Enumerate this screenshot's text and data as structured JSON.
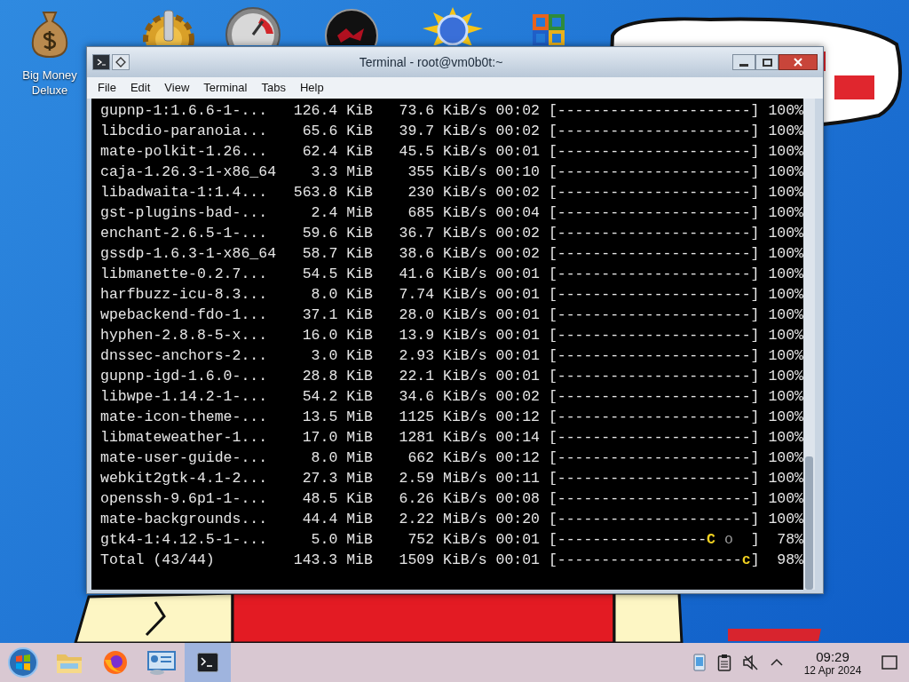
{
  "desktop": {
    "icons": [
      {
        "kind": "money-bag",
        "label": "Big Money Deluxe"
      },
      {
        "kind": "gear"
      },
      {
        "kind": "gauge"
      },
      {
        "kind": "disc"
      },
      {
        "kind": "sun-globe"
      },
      {
        "kind": "office"
      }
    ]
  },
  "window": {
    "title": "Terminal - root@vm0b0t:~",
    "menu": [
      "File",
      "Edit",
      "View",
      "Terminal",
      "Tabs",
      "Help"
    ],
    "rows": [
      {
        "name": "gupnp-1:1.6.6-1-...",
        "size": "126.4 KiB",
        "rate": "73.6 KiB/s",
        "time": "00:02",
        "bar": [
          {
            "kind": "trail",
            "text": "[----------------------]"
          }
        ],
        "percent": "100%"
      },
      {
        "name": "libcdio-paranoia...",
        "size": "65.6 KiB",
        "rate": "39.7 KiB/s",
        "time": "00:02",
        "bar": [
          {
            "kind": "trail",
            "text": "[----------------------]"
          }
        ],
        "percent": "100%"
      },
      {
        "name": "mate-polkit-1.26...",
        "size": "62.4 KiB",
        "rate": "45.5 KiB/s",
        "time": "00:01",
        "bar": [
          {
            "kind": "trail",
            "text": "[----------------------]"
          }
        ],
        "percent": "100%"
      },
      {
        "name": "caja-1.26.3-1-x86_64",
        "size": "3.3 MiB",
        "rate": "355 KiB/s",
        "time": "00:10",
        "bar": [
          {
            "kind": "trail",
            "text": "[----------------------]"
          }
        ],
        "percent": "100%"
      },
      {
        "name": "libadwaita-1:1.4...",
        "size": "563.8 KiB",
        "rate": "230 KiB/s",
        "time": "00:02",
        "bar": [
          {
            "kind": "trail",
            "text": "[----------------------]"
          }
        ],
        "percent": "100%"
      },
      {
        "name": "gst-plugins-bad-...",
        "size": "2.4 MiB",
        "rate": "685 KiB/s",
        "time": "00:04",
        "bar": [
          {
            "kind": "trail",
            "text": "[----------------------]"
          }
        ],
        "percent": "100%"
      },
      {
        "name": "enchant-2.6.5-1-...",
        "size": "59.6 KiB",
        "rate": "36.7 KiB/s",
        "time": "00:02",
        "bar": [
          {
            "kind": "trail",
            "text": "[----------------------]"
          }
        ],
        "percent": "100%"
      },
      {
        "name": "gssdp-1.6.3-1-x86_64",
        "size": "58.7 KiB",
        "rate": "38.6 KiB/s",
        "time": "00:02",
        "bar": [
          {
            "kind": "trail",
            "text": "[----------------------]"
          }
        ],
        "percent": "100%"
      },
      {
        "name": "libmanette-0.2.7...",
        "size": "54.5 KiB",
        "rate": "41.6 KiB/s",
        "time": "00:01",
        "bar": [
          {
            "kind": "trail",
            "text": "[----------------------]"
          }
        ],
        "percent": "100%"
      },
      {
        "name": "harfbuzz-icu-8.3...",
        "size": "8.0 KiB",
        "rate": "7.74 KiB/s",
        "time": "00:01",
        "bar": [
          {
            "kind": "trail",
            "text": "[----------------------]"
          }
        ],
        "percent": "100%"
      },
      {
        "name": "wpebackend-fdo-1...",
        "size": "37.1 KiB",
        "rate": "28.0 KiB/s",
        "time": "00:01",
        "bar": [
          {
            "kind": "trail",
            "text": "[----------------------]"
          }
        ],
        "percent": "100%"
      },
      {
        "name": "hyphen-2.8.8-5-x...",
        "size": "16.0 KiB",
        "rate": "13.9 KiB/s",
        "time": "00:01",
        "bar": [
          {
            "kind": "trail",
            "text": "[----------------------]"
          }
        ],
        "percent": "100%"
      },
      {
        "name": "dnssec-anchors-2...",
        "size": "3.0 KiB",
        "rate": "2.93 KiB/s",
        "time": "00:01",
        "bar": [
          {
            "kind": "trail",
            "text": "[----------------------]"
          }
        ],
        "percent": "100%"
      },
      {
        "name": "gupnp-igd-1.6.0-...",
        "size": "28.8 KiB",
        "rate": "22.1 KiB/s",
        "time": "00:01",
        "bar": [
          {
            "kind": "trail",
            "text": "[----------------------]"
          }
        ],
        "percent": "100%"
      },
      {
        "name": "libwpe-1.14.2-1-...",
        "size": "54.2 KiB",
        "rate": "34.6 KiB/s",
        "time": "00:02",
        "bar": [
          {
            "kind": "trail",
            "text": "[----------------------]"
          }
        ],
        "percent": "100%"
      },
      {
        "name": "mate-icon-theme-...",
        "size": "13.5 MiB",
        "rate": "1125 KiB/s",
        "time": "00:12",
        "bar": [
          {
            "kind": "trail",
            "text": "[----------------------]"
          }
        ],
        "percent": "100%"
      },
      {
        "name": "libmateweather-1...",
        "size": "17.0 MiB",
        "rate": "1281 KiB/s",
        "time": "00:14",
        "bar": [
          {
            "kind": "trail",
            "text": "[----------------------]"
          }
        ],
        "percent": "100%"
      },
      {
        "name": "mate-user-guide-...",
        "size": "8.0 MiB",
        "rate": "662 KiB/s",
        "time": "00:12",
        "bar": [
          {
            "kind": "trail",
            "text": "[----------------------]"
          }
        ],
        "percent": "100%"
      },
      {
        "name": "webkit2gtk-4.1-2...",
        "size": "27.3 MiB",
        "rate": "2.59 MiB/s",
        "time": "00:11",
        "bar": [
          {
            "kind": "trail",
            "text": "[----------------------]"
          }
        ],
        "percent": "100%"
      },
      {
        "name": "openssh-9.6p1-1-...",
        "size": "48.5 KiB",
        "rate": "6.26 KiB/s",
        "time": "00:08",
        "bar": [
          {
            "kind": "trail",
            "text": "[----------------------]"
          }
        ],
        "percent": "100%"
      },
      {
        "name": "mate-backgrounds...",
        "size": "44.4 MiB",
        "rate": "2.22 MiB/s",
        "time": "00:20",
        "bar": [
          {
            "kind": "trail",
            "text": "[----------------------]"
          }
        ],
        "percent": "100%"
      },
      {
        "name": "gtk4-1:4.12.5-1-...",
        "size": "5.0 MiB",
        "rate": "752 KiB/s",
        "time": "00:01",
        "bar": [
          {
            "kind": "trail",
            "text": "[-----------------"
          },
          {
            "kind": "pacman",
            "text": "C"
          },
          {
            "kind": "pellet",
            "text": " o"
          },
          {
            "kind": "trail",
            "text": "  ]"
          }
        ],
        "percent": "78%"
      },
      {
        "name": "Total (43/44)",
        "size": "143.3 MiB",
        "rate": "1509 KiB/s",
        "time": "00:01",
        "bar": [
          {
            "kind": "trail",
            "text": "[---------------------"
          },
          {
            "kind": "pacman",
            "text": "c"
          },
          {
            "kind": "trail",
            "text": "]"
          }
        ],
        "percent": "98%"
      }
    ]
  },
  "taskbar": {
    "apps": [
      {
        "kind": "start",
        "selected": false
      },
      {
        "kind": "folder",
        "selected": false
      },
      {
        "kind": "browser",
        "selected": false
      },
      {
        "kind": "control-panel",
        "selected": false
      },
      {
        "kind": "terminal",
        "selected": true
      }
    ],
    "tray": [
      {
        "kind": "device"
      },
      {
        "kind": "clipboard"
      },
      {
        "kind": "speaker-muted"
      },
      {
        "kind": "caret"
      }
    ],
    "clock": {
      "time": "09:29",
      "date": "12 Apr 2024"
    }
  }
}
